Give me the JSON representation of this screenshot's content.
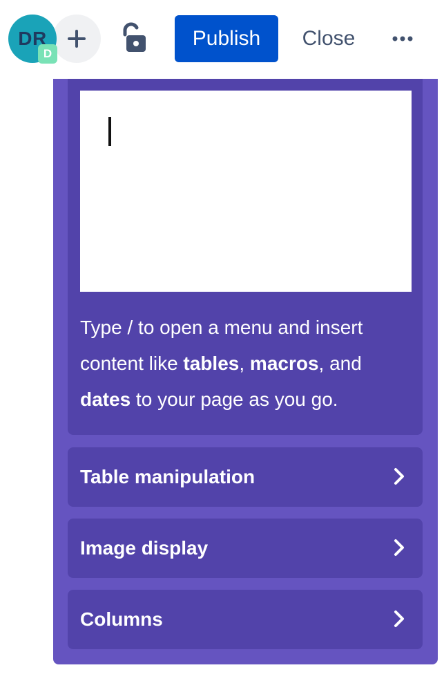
{
  "toolbar": {
    "avatar_initials": "DR",
    "avatar_badge": "D",
    "add_icon": "plus-icon",
    "lock_icon": "unlock-icon",
    "publish_label": "Publish",
    "close_label": "Close",
    "more_icon": "more-horizontal-icon"
  },
  "onboarding": {
    "intro": {
      "part1": "Type / to open a menu and insert content like ",
      "bold1": "tables",
      "sep1": ", ",
      "bold2": "macros",
      "sep2": ", and ",
      "bold3": "dates",
      "part2": " to your page as you go."
    },
    "items": [
      {
        "label": "Table manipulation"
      },
      {
        "label": "Image display"
      },
      {
        "label": "Columns"
      }
    ]
  },
  "colors": {
    "primary": "#0052cc",
    "panel": "#6554c0",
    "card": "#5243aa",
    "avatar": "#1aa3b8",
    "badge": "#79e2b6"
  }
}
